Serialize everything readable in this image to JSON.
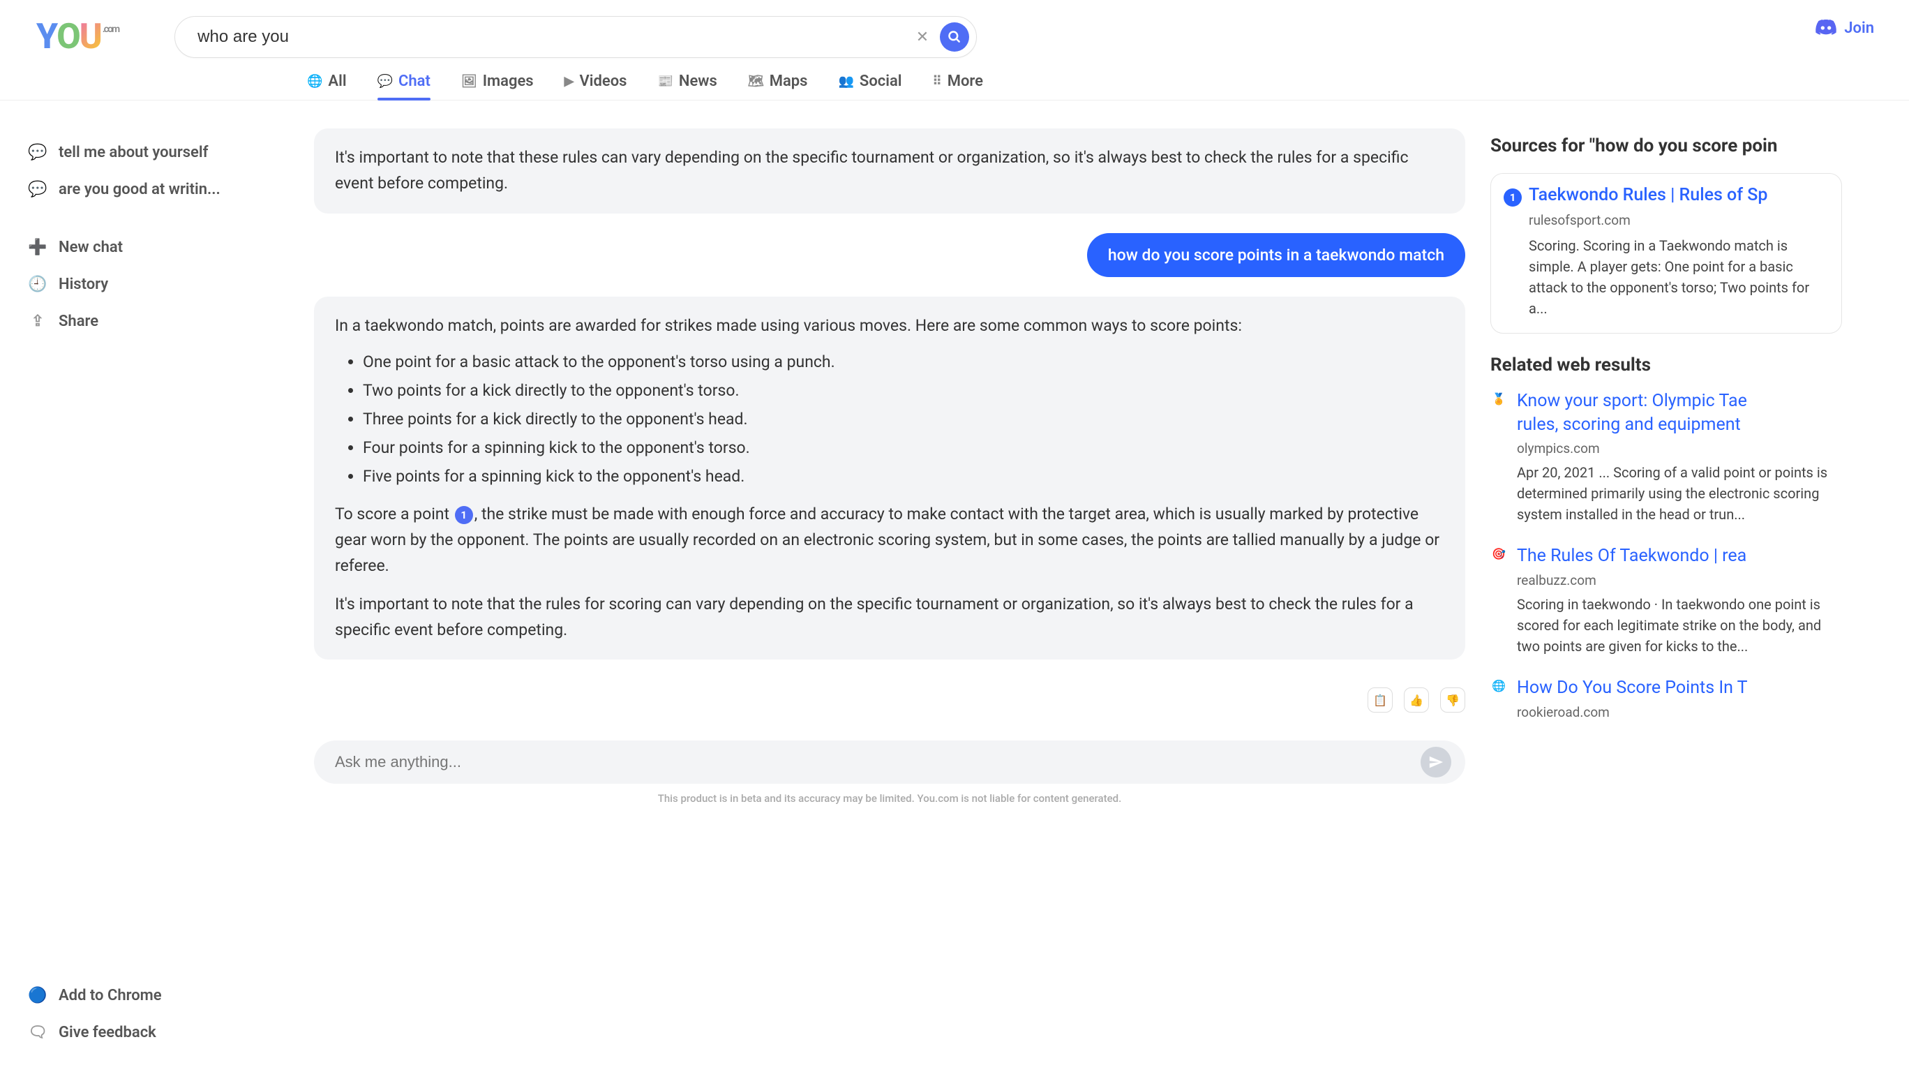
{
  "logo": {
    "com": ".com"
  },
  "search": {
    "value": "who are you"
  },
  "join_label": "Join",
  "tabs": [
    {
      "label": "All"
    },
    {
      "label": "Chat"
    },
    {
      "label": "Images"
    },
    {
      "label": "Videos"
    },
    {
      "label": "News"
    },
    {
      "label": "Maps"
    },
    {
      "label": "Social"
    },
    {
      "label": "More"
    }
  ],
  "sidebar": {
    "recent": [
      {
        "label": "tell me about yourself"
      },
      {
        "label": "are you good at writin..."
      }
    ],
    "actions": [
      {
        "label": "New chat"
      },
      {
        "label": "History"
      },
      {
        "label": "Share"
      }
    ],
    "bottom": [
      {
        "label": "Add to Chrome"
      },
      {
        "label": "Give feedback"
      }
    ]
  },
  "chat": {
    "prev_assistant_tail": "It's important to note that these rules can vary depending on the specific tournament or organization, so it's always best to check the rules for a specific event before competing.",
    "user_question": "how do you score points in a taekwondo match",
    "answer_intro": "In a taekwondo match, points are awarded for strikes made using various moves. Here are some common ways to score points:",
    "bullets": [
      "One point for a basic attack to the opponent's torso using a punch.",
      "Two points for a kick directly to the opponent's torso.",
      "Three points for a kick directly to the opponent's head.",
      "Four points for a spinning kick to the opponent's torso.",
      "Five points for a spinning kick to the opponent's head."
    ],
    "answer_para2_pre": "To score a point ",
    "citation_1": "1",
    "answer_para2_post": ", the strike must be made with enough force and accuracy to make contact with the target area, which is usually marked by protective gear worn by the opponent. The points are usually recorded on an electronic scoring system, but in some cases, the points are tallied manually by a judge or referee.",
    "answer_para3": "It's important to note that the rules for scoring can vary depending on the specific tournament or organization, so it's always best to check the rules for a specific event before competing.",
    "composer_placeholder": "Ask me anything...",
    "disclaimer": "This product is in beta and its accuracy may be limited. You.com is not liable for content generated."
  },
  "sources_heading": "Sources for \"how do you score poin",
  "sources": [
    {
      "num": "1",
      "title": "Taekwondo Rules | Rules of Sp",
      "domain": "rulesofsport.com",
      "snippet": "Scoring. Scoring in a Taekwondo match is simple. A player gets: One point for a basic attack to the opponent's torso; Two points for a..."
    }
  ],
  "related_heading": "Related web results",
  "related": [
    {
      "icon": "🏅",
      "title": "Know your sport: Olympic Tae",
      "title2": "rules, scoring and equipment",
      "domain": "olympics.com",
      "snippet": "Apr 20, 2021 ... Scoring of a valid point or points is determined primarily using the electronic scoring system installed in the head or trun..."
    },
    {
      "icon": "🎯",
      "title": "The Rules Of Taekwondo | rea",
      "domain": "realbuzz.com",
      "snippet": "Scoring in taekwondo · In taekwondo one point is scored for each legitimate strike on the body, and two points are given for kicks to the..."
    },
    {
      "icon": "🌐",
      "title": "How Do You Score Points In T",
      "domain": "rookieroad.com",
      "snippet": ""
    }
  ]
}
